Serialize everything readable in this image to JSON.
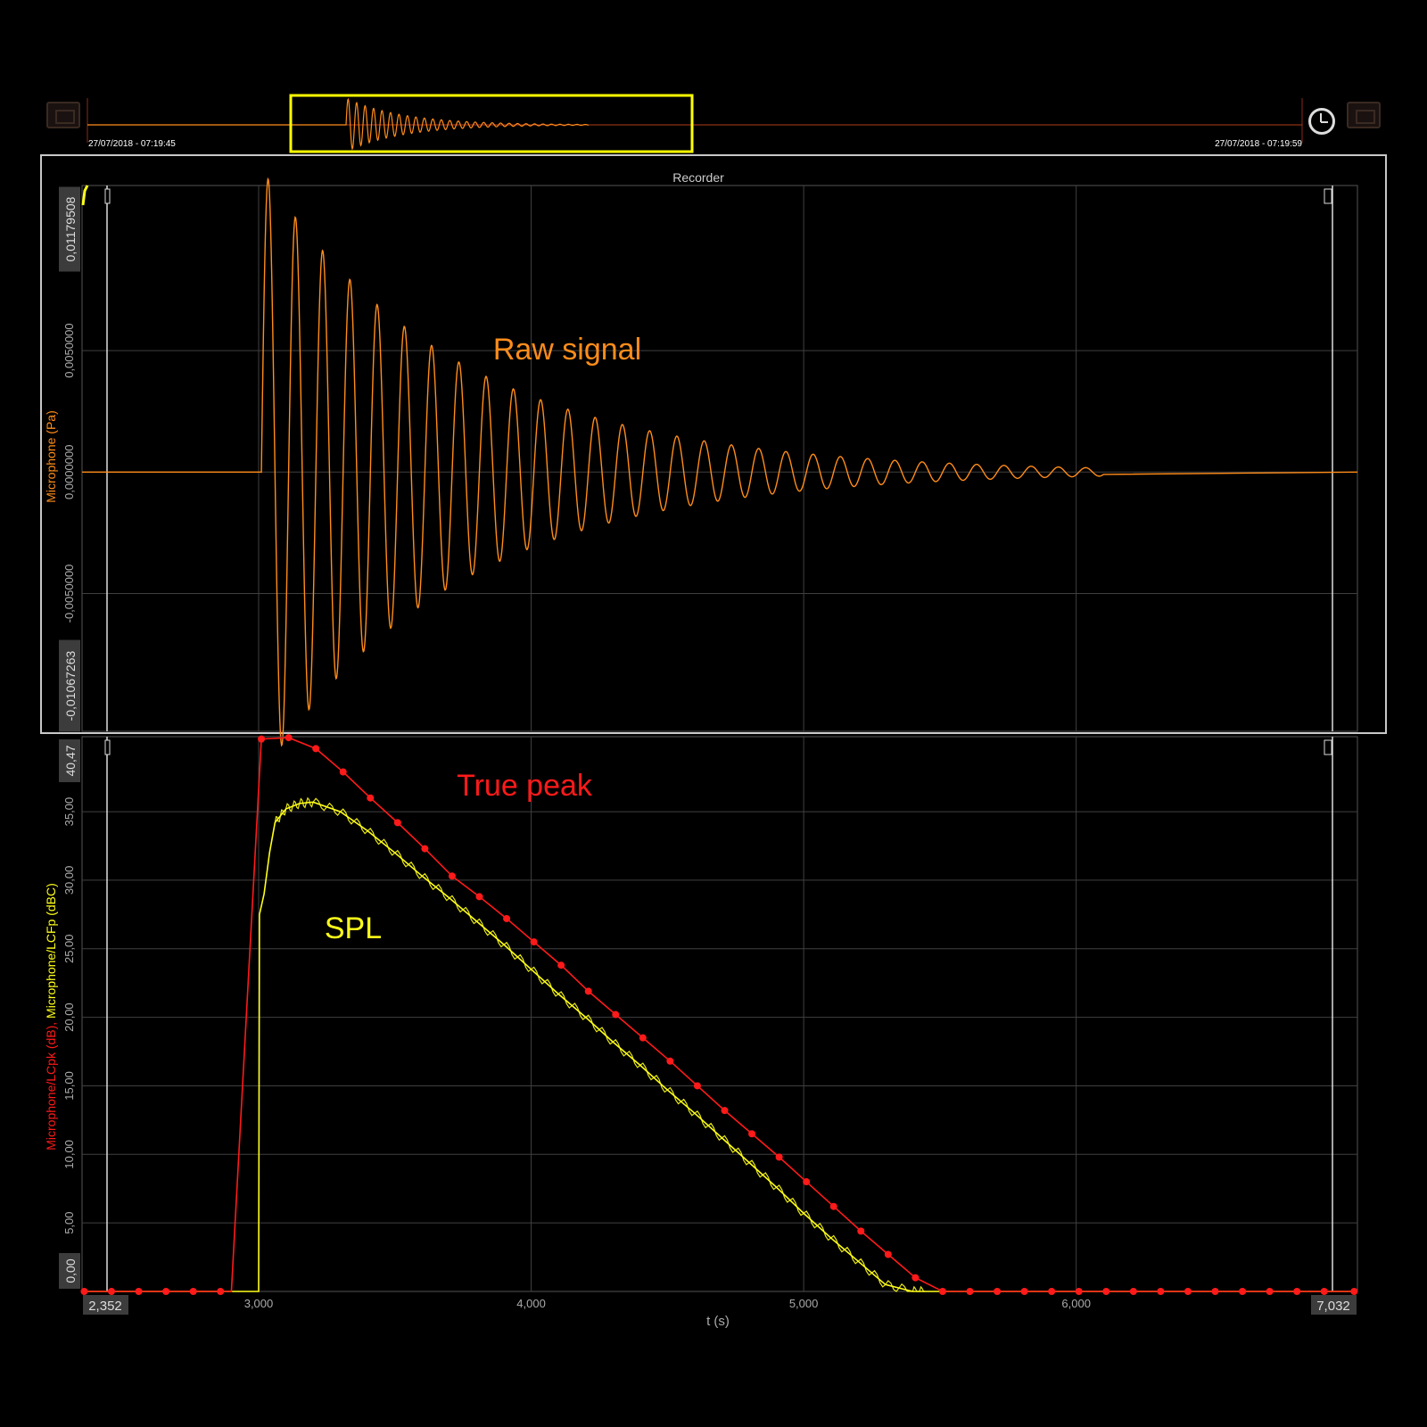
{
  "overview": {
    "start_time": "27/07/2018 - 07:19:45",
    "end_time": "27/07/2018 - 07:19:59"
  },
  "recorder": {
    "title": "Recorder"
  },
  "colors": {
    "raw": "#ff8c1a",
    "peak": "#ff1a1a",
    "spl": "#ffff1a",
    "grid": "#404040",
    "frame": "#c8c8c8",
    "overview_window": "#ffff00"
  },
  "icons": {
    "left": "panel-icon",
    "right": "panel-icon",
    "clock": "clock-icon"
  },
  "chart_data": [
    {
      "type": "line",
      "series": [
        {
          "name": "Raw signal",
          "envelope": {
            "onset_x": 3.01,
            "initial_amplitude": 0.0125,
            "freq_hz": 10,
            "decay_rate": 1.4,
            "end_x": 6.1
          }
        }
      ],
      "ylabel": "Microphone (Pa)",
      "ylim": [
        -0.01067263,
        0.01179508
      ],
      "yticks": [
        -0.005,
        0.0,
        0.005
      ],
      "ytick_labels": [
        "-0,0050000",
        "0,0000000",
        "0,0050000"
      ],
      "ymin_label": "-0,01067263",
      "ymax_label": "0,01179508",
      "xlim": [
        2.352,
        7.032
      ],
      "xticks": [
        3.0,
        4.0,
        5.0,
        6.0
      ],
      "grid": true,
      "annotation": "Raw signal"
    },
    {
      "type": "line",
      "series": [
        {
          "name": "True peak",
          "x": [
            2.36,
            2.46,
            2.56,
            2.66,
            2.76,
            2.86,
            2.9,
            3.01,
            3.11,
            3.21,
            3.31,
            3.41,
            3.51,
            3.61,
            3.71,
            3.81,
            3.91,
            4.01,
            4.11,
            4.21,
            4.31,
            4.41,
            4.51,
            4.61,
            4.71,
            4.81,
            4.91,
            5.01,
            5.11,
            5.21,
            5.31,
            5.41,
            5.51,
            5.61,
            5.71,
            5.81,
            5.91,
            6.01,
            6.11,
            6.21,
            6.31,
            6.41,
            6.51,
            6.61,
            6.71,
            6.81,
            6.91,
            7.02
          ],
          "y": [
            0,
            0,
            0,
            0,
            0,
            0,
            0,
            40.3,
            40.4,
            39.6,
            37.9,
            36.0,
            34.2,
            32.3,
            30.3,
            28.8,
            27.2,
            25.5,
            23.8,
            21.9,
            20.2,
            18.5,
            16.8,
            15.0,
            13.2,
            11.5,
            9.8,
            8.0,
            6.2,
            4.4,
            2.7,
            1.0,
            0,
            0,
            0,
            0,
            0,
            0,
            0,
            0,
            0,
            0,
            0,
            0,
            0,
            0,
            0,
            0
          ]
        },
        {
          "name": "SPL",
          "x": [
            2.352,
            3.0,
            3.003,
            3.02,
            3.04,
            3.06,
            3.1,
            3.15,
            3.2,
            3.3,
            3.4,
            3.5,
            3.6,
            3.7,
            3.8,
            3.9,
            4.0,
            4.1,
            4.2,
            4.3,
            4.4,
            4.5,
            4.6,
            4.7,
            4.8,
            4.9,
            5.0,
            5.1,
            5.2,
            5.3,
            5.4,
            5.45,
            7.032
          ],
          "y": [
            0,
            0,
            27.5,
            29.0,
            32.0,
            34.2,
            35.2,
            35.6,
            35.7,
            35.0,
            33.6,
            32.0,
            30.3,
            28.7,
            27.0,
            25.3,
            23.5,
            21.7,
            20.0,
            18.2,
            16.5,
            14.7,
            13.0,
            11.2,
            9.4,
            7.6,
            5.7,
            3.9,
            2.2,
            0.5,
            0,
            0,
            0
          ]
        }
      ],
      "ylabel_parts": [
        {
          "text": "Microphone/LCpk (dB), ",
          "color": "#ff1a1a"
        },
        {
          "text": "Microphone/LCFp (dBC)",
          "color": "#ffff1a"
        }
      ],
      "ylim": [
        0,
        40.47
      ],
      "yticks": [
        5,
        10,
        15,
        20,
        25,
        30,
        35
      ],
      "ytick_labels": [
        "5,00",
        "10,00",
        "15,00",
        "20,00",
        "25,00",
        "30,00",
        "35,00"
      ],
      "ymin_label": "0,00",
      "ymax_label": "40,47",
      "xlim": [
        2.352,
        7.032
      ],
      "xticks": [
        3.0,
        4.0,
        5.0,
        6.0
      ],
      "xtick_labels": [
        "3,000",
        "4,000",
        "5,000",
        "6,000"
      ],
      "xmin_label": "2,352",
      "xmax_label": "7,032",
      "xlabel": "t (s)",
      "grid": true,
      "annotations": [
        "True peak",
        "SPL"
      ]
    }
  ]
}
